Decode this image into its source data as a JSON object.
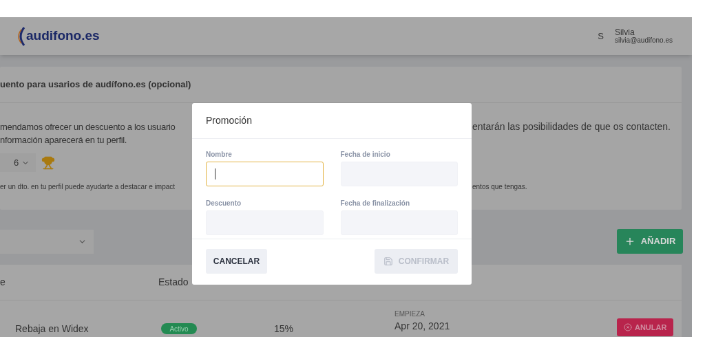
{
  "header": {
    "logo": "audifono.es",
    "user": {
      "initial": "S",
      "name": "Silvia",
      "email": "silvia@audifono.es"
    }
  },
  "discount_card": {
    "title": "uento para usarios de audífono.es (opcional)",
    "text_left": [
      "mendamos ofrecer un descuento a los usuario",
      "nformación aparecerá en tu perfil."
    ],
    "text_right": "entarán las posibilidades de que os contacten.",
    "select_value": "6",
    "note_left": "er un dto. en tu perfil puede ayudarte a destacar e impact",
    "note_right": "entos que tengas."
  },
  "toolbar": {
    "add_button": "AÑADIR"
  },
  "table": {
    "columns": [
      "e",
      "Estado"
    ],
    "rows": [
      {
        "name": "Rebaja en Widex",
        "status": "Activo",
        "discount": "15%",
        "period_label": "EMPIEZA",
        "period_start": "Apr 20, 2021",
        "action": "ANULAR"
      }
    ]
  },
  "modal": {
    "title": "Promoción",
    "fields": [
      {
        "label": "Nombre",
        "focused": true
      },
      {
        "label": "Fecha de inicio",
        "focused": false
      },
      {
        "label": "Descuento",
        "focused": false
      },
      {
        "label": "Fecha de finalización",
        "focused": false
      }
    ],
    "buttons": [
      {
        "label": "CANCELAR",
        "kind": "cancel",
        "disabled": false
      },
      {
        "label": "CONFIRMAR",
        "kind": "confirm",
        "disabled": true
      }
    ]
  }
}
